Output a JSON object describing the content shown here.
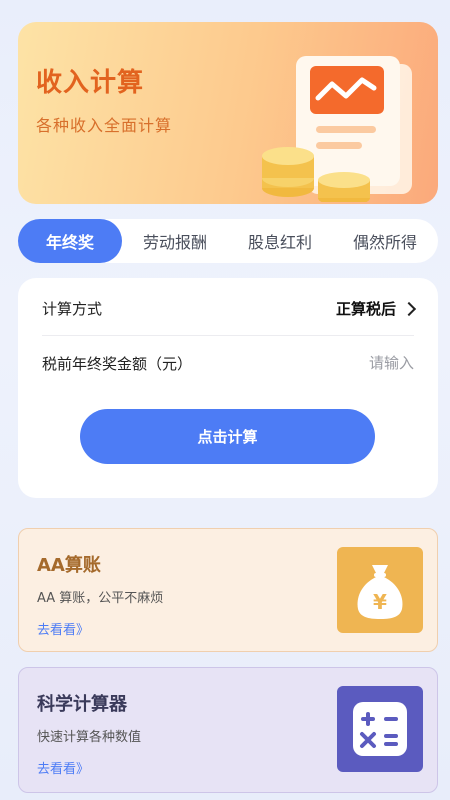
{
  "banner": {
    "title": "收入计算",
    "subtitle": "各种收入全面计算"
  },
  "tabs": [
    {
      "label": "年终奖",
      "active": true
    },
    {
      "label": "劳动报酬",
      "active": false
    },
    {
      "label": "股息红利",
      "active": false
    },
    {
      "label": "偶然所得",
      "active": false
    }
  ],
  "form": {
    "method_label": "计算方式",
    "method_value": "正算税后",
    "amount_label": "税前年终奖金额（元）",
    "amount_placeholder": "请输入",
    "amount_value": "",
    "submit_label": "点击计算"
  },
  "features": {
    "aa": {
      "title": "AA算账",
      "desc": "AA 算账，公平不麻烦",
      "link": "去看看》",
      "icon": "money-bag-icon"
    },
    "science": {
      "title": "科学计算器",
      "desc": "快速计算各种数值",
      "link": "去看看》",
      "icon": "calculator-icon"
    }
  },
  "colors": {
    "primary": "#4d7cf5",
    "banner_title": "#e2631f",
    "aa_title": "#a56a2c",
    "aa_icon_bg": "#efb552",
    "science_icon_bg": "#5b5bbf"
  }
}
